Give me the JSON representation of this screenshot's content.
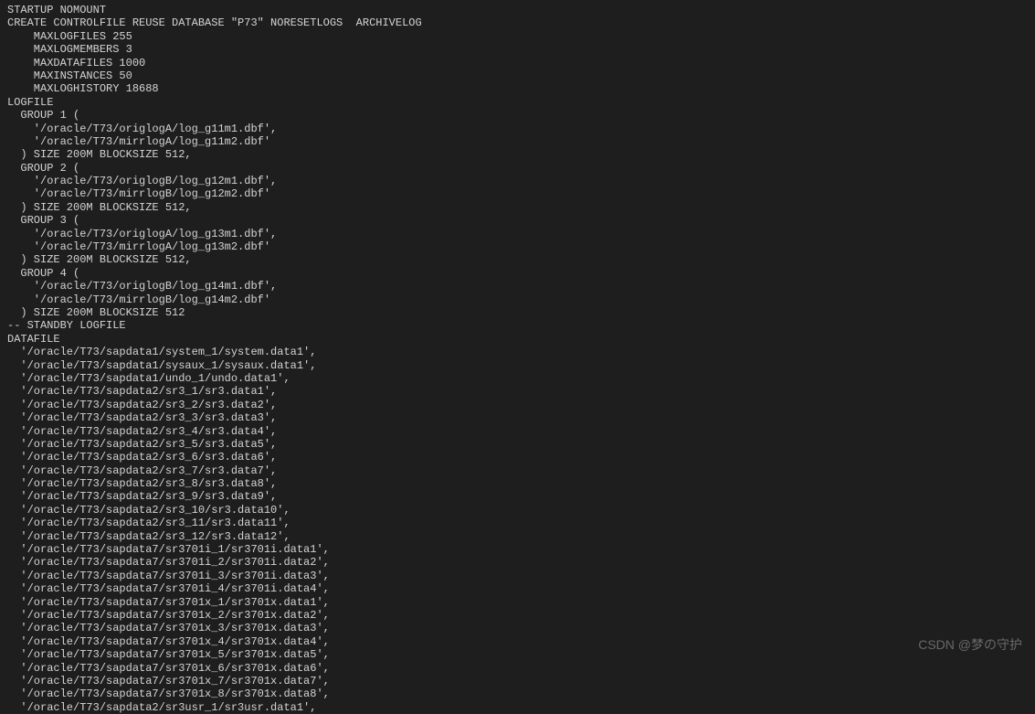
{
  "terminal": {
    "lines": [
      "STARTUP NOMOUNT",
      "CREATE CONTROLFILE REUSE DATABASE \"P73\" NORESETLOGS  ARCHIVELOG",
      "    MAXLOGFILES 255",
      "    MAXLOGMEMBERS 3",
      "    MAXDATAFILES 1000",
      "    MAXINSTANCES 50",
      "    MAXLOGHISTORY 18688",
      "LOGFILE",
      "  GROUP 1 (",
      "    '/oracle/T73/origlogA/log_g11m1.dbf',",
      "    '/oracle/T73/mirrlogA/log_g11m2.dbf'",
      "  ) SIZE 200M BLOCKSIZE 512,",
      "  GROUP 2 (",
      "    '/oracle/T73/origlogB/log_g12m1.dbf',",
      "    '/oracle/T73/mirrlogB/log_g12m2.dbf'",
      "  ) SIZE 200M BLOCKSIZE 512,",
      "  GROUP 3 (",
      "    '/oracle/T73/origlogA/log_g13m1.dbf',",
      "    '/oracle/T73/mirrlogA/log_g13m2.dbf'",
      "  ) SIZE 200M BLOCKSIZE 512,",
      "  GROUP 4 (",
      "    '/oracle/T73/origlogB/log_g14m1.dbf',",
      "    '/oracle/T73/mirrlogB/log_g14m2.dbf'",
      "  ) SIZE 200M BLOCKSIZE 512",
      "-- STANDBY LOGFILE",
      "DATAFILE",
      "  '/oracle/T73/sapdata1/system_1/system.data1',",
      "  '/oracle/T73/sapdata1/sysaux_1/sysaux.data1',",
      "  '/oracle/T73/sapdata1/undo_1/undo.data1',",
      "  '/oracle/T73/sapdata2/sr3_1/sr3.data1',",
      "  '/oracle/T73/sapdata2/sr3_2/sr3.data2',",
      "  '/oracle/T73/sapdata2/sr3_3/sr3.data3',",
      "  '/oracle/T73/sapdata2/sr3_4/sr3.data4',",
      "  '/oracle/T73/sapdata2/sr3_5/sr3.data5',",
      "  '/oracle/T73/sapdata2/sr3_6/sr3.data6',",
      "  '/oracle/T73/sapdata2/sr3_7/sr3.data7',",
      "  '/oracle/T73/sapdata2/sr3_8/sr3.data8',",
      "  '/oracle/T73/sapdata2/sr3_9/sr3.data9',",
      "  '/oracle/T73/sapdata2/sr3_10/sr3.data10',",
      "  '/oracle/T73/sapdata2/sr3_11/sr3.data11',",
      "  '/oracle/T73/sapdata2/sr3_12/sr3.data12',",
      "  '/oracle/T73/sapdata7/sr3701i_1/sr3701i.data1',",
      "  '/oracle/T73/sapdata7/sr3701i_2/sr3701i.data2',",
      "  '/oracle/T73/sapdata7/sr3701i_3/sr3701i.data3',",
      "  '/oracle/T73/sapdata7/sr3701i_4/sr3701i.data4',",
      "  '/oracle/T73/sapdata7/sr3701x_1/sr3701x.data1',",
      "  '/oracle/T73/sapdata7/sr3701x_2/sr3701x.data2',",
      "  '/oracle/T73/sapdata7/sr3701x_3/sr3701x.data3',",
      "  '/oracle/T73/sapdata7/sr3701x_4/sr3701x.data4',",
      "  '/oracle/T73/sapdata7/sr3701x_5/sr3701x.data5',",
      "  '/oracle/T73/sapdata7/sr3701x_6/sr3701x.data6',",
      "  '/oracle/T73/sapdata7/sr3701x_7/sr3701x.data7',",
      "  '/oracle/T73/sapdata7/sr3701x_8/sr3701x.data8',",
      "  '/oracle/T73/sapdata2/sr3usr_1/sr3usr.data1',"
    ]
  },
  "watermark": "CSDN @梦の守护"
}
